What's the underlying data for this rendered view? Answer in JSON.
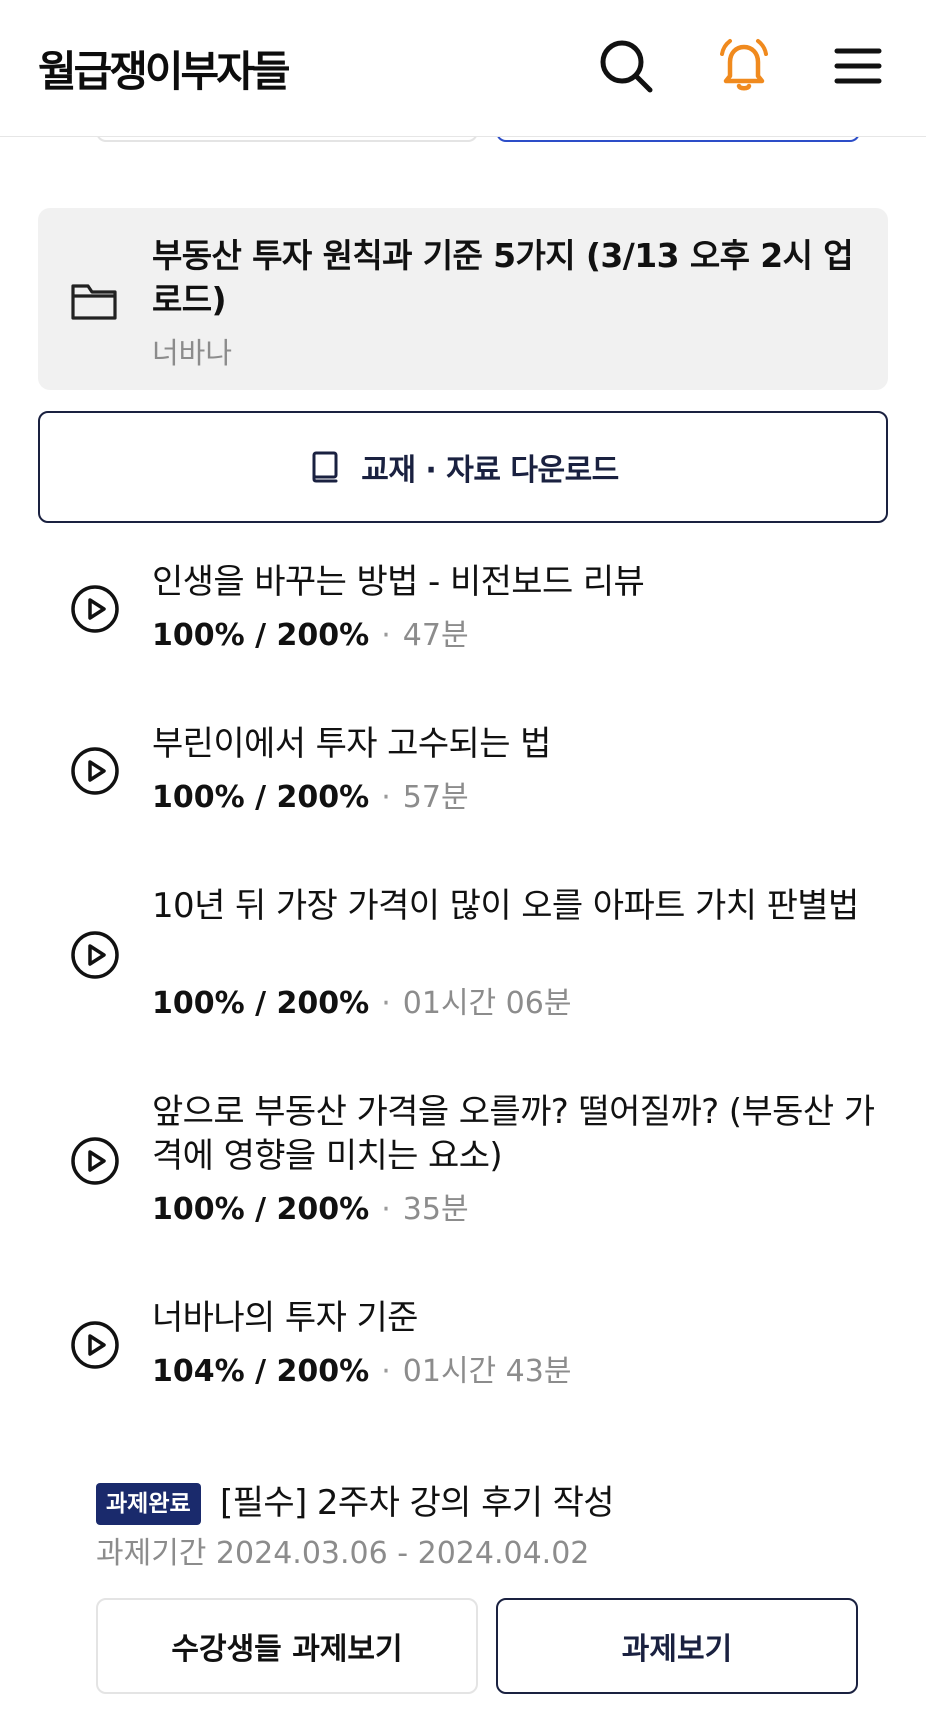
{
  "header": {
    "title": "월급쟁이부자들",
    "icons": [
      "search-icon",
      "bell-icon",
      "menu-icon"
    ],
    "bell_color": "#F08A1E"
  },
  "folder": {
    "icon": "folder-icon",
    "title": "부동산 투자 원칙과 기준 5가지 (3/13 오후 2시 업로드)",
    "author": "너바나"
  },
  "download": {
    "icon": "book-icon",
    "label": "교재 · 자료 다운로드"
  },
  "lectures": [
    {
      "title": "인생을 바꾸는 방법 - 비전보드 리뷰",
      "progress": "100% / 200%",
      "separator": "·",
      "duration": "47분"
    },
    {
      "title": "부린이에서 투자 고수되는 법",
      "progress": "100% / 200%",
      "separator": "·",
      "duration": "57분"
    },
    {
      "title": "10년 뒤 가장 가격이 많이 오를 아파트 가치 판별법",
      "progress": "100% / 200%",
      "separator": "·",
      "duration": "01시간 06분"
    },
    {
      "title": "앞으로 부동산 가격을 오를까? 떨어질까? (부동산 가격에 영향을 미치는 요소)",
      "progress": "100% / 200%",
      "separator": "·",
      "duration": "35분"
    },
    {
      "title": "너바나의 투자 기준",
      "progress": "104% / 200%",
      "separator": "·",
      "duration": "01시간 43분"
    }
  ],
  "task": {
    "badge": "과제완료",
    "title": "[필수] 2주차 강의 후기 작성",
    "period": "과제기간 2024.03.06 - 2024.04.02",
    "view_others_label": "수강생들 과제보기",
    "view_label": "과제보기"
  },
  "colors": {
    "navy": "#1A2140",
    "badge_bg": "#1A2A6C",
    "card_bg": "#F1F1F1",
    "accent_orange": "#F08A1E"
  }
}
